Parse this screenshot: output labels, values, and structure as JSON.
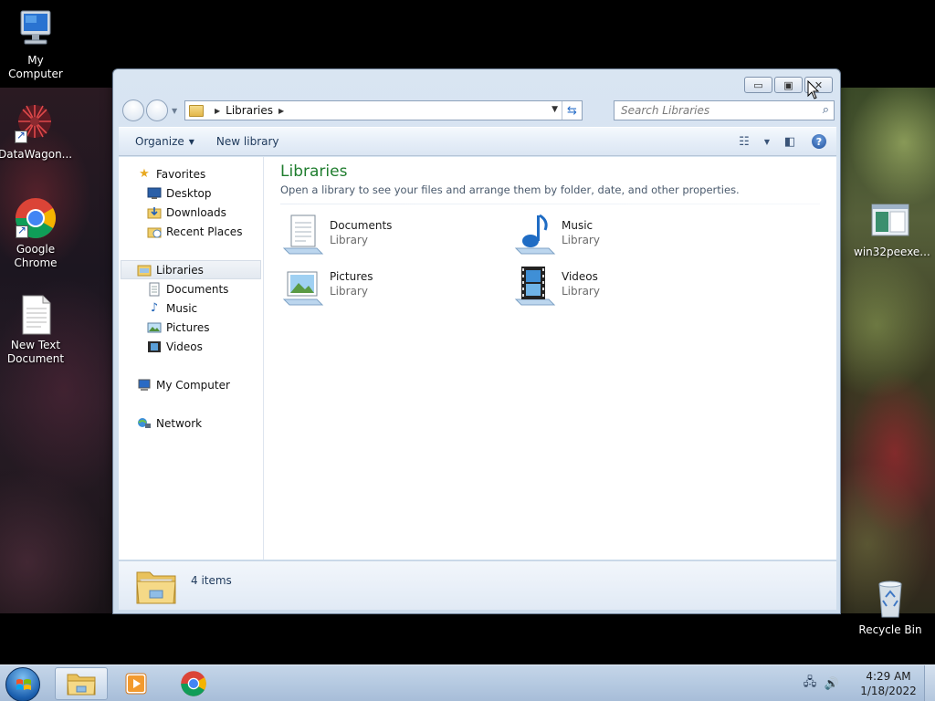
{
  "desktop": {
    "icons": [
      {
        "label": "My Computer"
      },
      {
        "label": "DataWagon..."
      },
      {
        "label": "Google Chrome"
      },
      {
        "label": "New Text Document"
      },
      {
        "label": "win32peexe..."
      },
      {
        "label": "Recycle Bin"
      }
    ]
  },
  "window": {
    "address": {
      "crumb": "Libraries",
      "search_placeholder": "Search Libraries"
    },
    "toolbar": {
      "organize_label": "Organize",
      "new_library_label": "New library"
    },
    "nav": {
      "favorites": "Favorites",
      "favorites_items": [
        "Desktop",
        "Downloads",
        "Recent Places"
      ],
      "libraries": "Libraries",
      "libraries_items": [
        "Documents",
        "Music",
        "Pictures",
        "Videos"
      ],
      "computer": "My Computer",
      "network": "Network"
    },
    "main": {
      "title": "Libraries",
      "description": "Open a library to see your files and arrange them by folder, date, and other properties.",
      "libraries": [
        {
          "name": "Documents",
          "type": "Library",
          "icon": "documents-library-icon"
        },
        {
          "name": "Music",
          "type": "Library",
          "icon": "music-library-icon"
        },
        {
          "name": "Pictures",
          "type": "Library",
          "icon": "pictures-library-icon"
        },
        {
          "name": "Videos",
          "type": "Library",
          "icon": "videos-library-icon"
        }
      ]
    },
    "details": {
      "count": "4 items"
    }
  },
  "taskbar": {
    "clock_time": "4:29 AM",
    "clock_date": "1/18/2022"
  },
  "colors": {
    "title_green": "#1f7d2e",
    "taskbar": "#b7cbe2",
    "window_frame": "#d9e5f2"
  }
}
